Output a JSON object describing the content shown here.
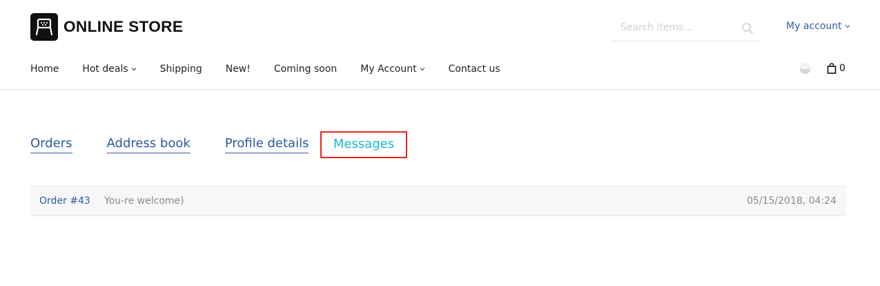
{
  "brand": {
    "name": "ONLINE STORE",
    "logo_icon": "store-logo-icon"
  },
  "search": {
    "placeholder": "Search items...",
    "value": "",
    "icon": "search-icon"
  },
  "header": {
    "my_account": "My account"
  },
  "nav": {
    "items": [
      {
        "label": "Home",
        "has_dropdown": false
      },
      {
        "label": "Hot deals",
        "has_dropdown": true
      },
      {
        "label": "Shipping",
        "has_dropdown": false
      },
      {
        "label": "New!",
        "has_dropdown": false
      },
      {
        "label": "Coming soon",
        "has_dropdown": false
      },
      {
        "label": "My Account",
        "has_dropdown": true
      },
      {
        "label": "Contact us",
        "has_dropdown": false
      }
    ]
  },
  "cart": {
    "count": "0",
    "icon": "shopping-bag-icon"
  },
  "theme": {
    "icon": "theme-toggle-icon"
  },
  "tabs": {
    "items": [
      {
        "label": "Orders",
        "active": false
      },
      {
        "label": "Address book",
        "active": false
      },
      {
        "label": "Profile details",
        "active": false
      },
      {
        "label": "Messages",
        "active": true
      }
    ]
  },
  "messages": [
    {
      "order": "Order #43",
      "text": "You-re welcome)",
      "date": "05/15/2018, 04:24"
    }
  ],
  "colors": {
    "link": "#2b5aa0",
    "active_tab": "#1ab8cf",
    "highlight_border": "#e8231d",
    "row_background": "#f7f7f7"
  }
}
